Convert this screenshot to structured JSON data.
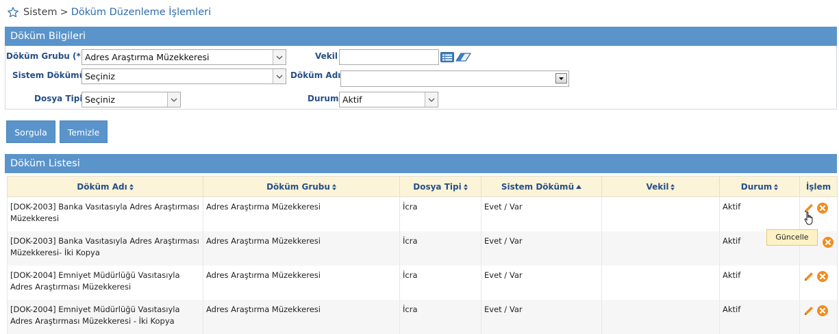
{
  "breadcrumb": {
    "root": "Sistem",
    "separator": ">",
    "current": "Döküm Düzenleme İşlemleri"
  },
  "filters_panel": {
    "title": "Döküm Bilgileri",
    "dokum_grubu": {
      "label": "Döküm Grubu (*)",
      "value": "Adres Araştırma Müzekkeresi"
    },
    "vekil": {
      "label": "Vekil",
      "value": ""
    },
    "sistem_dokumu": {
      "label": "Sistem Dökümü",
      "value": "Seçiniz"
    },
    "dokum_adi": {
      "label": "Döküm Adı",
      "value": ""
    },
    "dosya_tipi": {
      "label": "Dosya Tipi",
      "value": "Seçiniz"
    },
    "durum": {
      "label": "Durum",
      "value": "Aktif"
    }
  },
  "buttons": {
    "query": "Sorgula",
    "clear": "Temizle"
  },
  "list_panel": {
    "title": "Döküm Listesi",
    "columns": [
      "Döküm Adı",
      "Döküm Grubu",
      "Dosya Tipi",
      "Sistem Dökümü",
      "Vekil",
      "Durum",
      "İşlem"
    ],
    "rows": [
      {
        "name": "[DOK-2003] Banka Vasıtasıyla Adres Araştırması Müzekkeresi",
        "group": "Adres Araştırma Müzekkeresi",
        "file_type": "İcra",
        "system": "Evet / Var",
        "vekil": "",
        "status": "Aktif"
      },
      {
        "name": "[DOK-2003] Banka Vasıtasıyla Adres Araştırması Müzekkeresi- İki Kopya",
        "group": "Adres Araştırma Müzekkeresi",
        "file_type": "İcra",
        "system": "Evet / Var",
        "vekil": "",
        "status": "Aktif"
      },
      {
        "name": "[DOK-2004] Emniyet Müdürlüğü Vasıtasıyla Adres Araştırması Müzekkeresi",
        "group": "Adres Araştırma Müzekkeresi",
        "file_type": "İcra",
        "system": "Evet / Var",
        "vekil": "",
        "status": "Aktif"
      },
      {
        "name": "[DOK-2004] Emniyet Müdürlüğü Vasıtasıyla Adres Araştırması Müzekkeresi - İki Kopya",
        "group": "Adres Araştırma Müzekkeresi",
        "file_type": "İcra",
        "system": "Evet / Var",
        "vekil": "",
        "status": "Aktif"
      }
    ]
  },
  "tooltip": "Güncelle",
  "colors": {
    "panel_header": "#5a94cb",
    "label_text": "#264f86",
    "table_header_bg": "#fcf4d8",
    "action_orange": "#f28c1c"
  },
  "icons": {
    "breadcrumb": "star-icon",
    "edit": "pencil-icon",
    "delete": "delete-x-icon",
    "calendar": "list-icon",
    "eraser": "eraser-icon"
  }
}
